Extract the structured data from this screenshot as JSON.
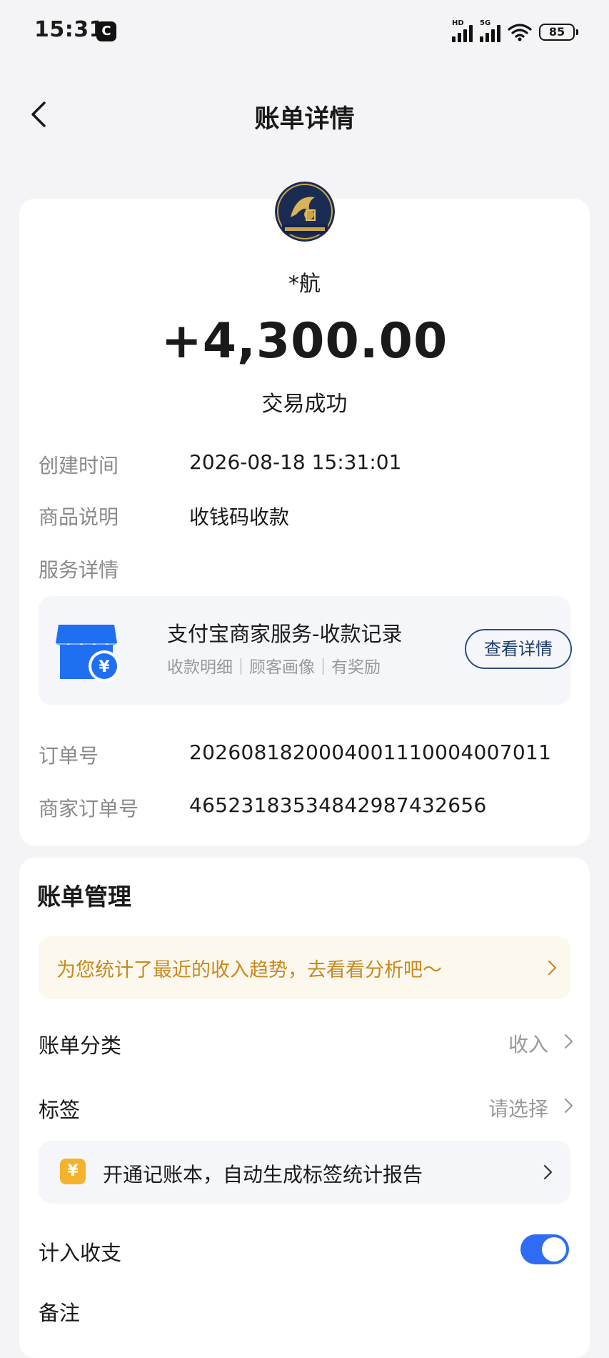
{
  "status_bar": {
    "time": "15:31",
    "battery": "85",
    "signal1_label": "HD",
    "signal2_label": "5G"
  },
  "nav": {
    "title": "账单详情"
  },
  "transaction": {
    "payer": "*航",
    "amount": "+4,300.00",
    "status": "交易成功",
    "details": [
      {
        "label": "创建时间",
        "value": "2026-08-18 15:31:01"
      },
      {
        "label": "商品说明",
        "value": "收钱码收款"
      }
    ],
    "service_label": "服务详情",
    "service": {
      "title": "支付宝商家服务-收款记录",
      "subtitle": "收款明细｜顾客画像｜有奖励",
      "button": "查看详情"
    },
    "order_no_label": "订单号",
    "order_no": "2026081820004001110004007011",
    "merchant_order_label": "商家订单号",
    "merchant_order_no": "4652318353484298743265​6"
  },
  "management": {
    "title": "账单管理",
    "banner_text": "为您统计了最近的收入趋势，去看看分析吧～",
    "category_label": "账单分类",
    "category_value": "收入",
    "tag_label": "标签",
    "tag_value": "请选择",
    "ledger_icon": "¥",
    "ledger_text": "开通记账本，自动生成标签统计报告",
    "include_label": "计入收支",
    "include_enabled": true,
    "remark_label": "备注"
  },
  "colors": {
    "accent_blue": "#2e6cf6",
    "banner_text": "#c8891e",
    "button_border": "#2f4d7d"
  }
}
